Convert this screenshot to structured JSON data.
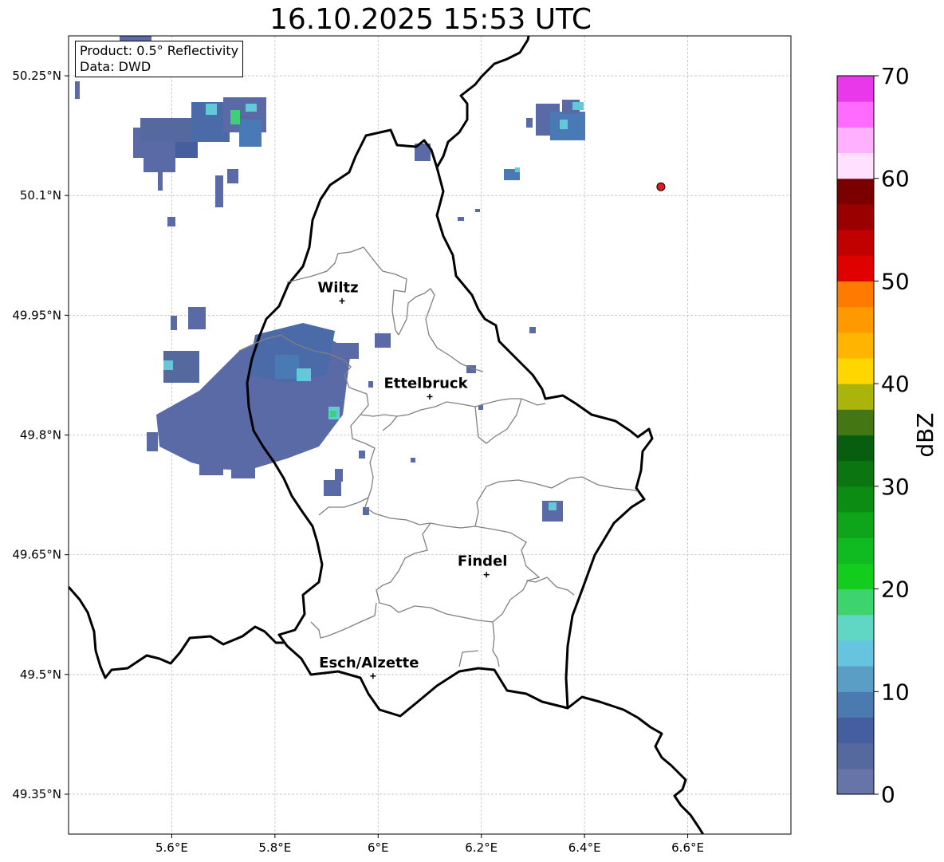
{
  "title": "16.10.2025 15:53 UTC",
  "info": {
    "product": "Product: 0.5° Reflectivity",
    "data": "Data: DWD"
  },
  "map": {
    "lon_range": [
      5.4,
      6.8
    ],
    "lat_range": [
      49.3,
      50.3
    ],
    "lon_ticks": [
      {
        "value": 5.6,
        "label": "5.6°E"
      },
      {
        "value": 5.8,
        "label": "5.8°E"
      },
      {
        "value": 6.0,
        "label": "6°E"
      },
      {
        "value": 6.2,
        "label": "6.2°E"
      },
      {
        "value": 6.4,
        "label": "6.4°E"
      },
      {
        "value": 6.6,
        "label": "6.6°E"
      }
    ],
    "lat_ticks": [
      {
        "value": 50.25,
        "label": "50.25°N"
      },
      {
        "value": 50.1,
        "label": "50.1°N"
      },
      {
        "value": 49.95,
        "label": "49.95°N"
      },
      {
        "value": 49.8,
        "label": "49.8°N"
      },
      {
        "value": 49.65,
        "label": "49.65°N"
      },
      {
        "value": 49.5,
        "label": "49.5°N"
      },
      {
        "value": 49.35,
        "label": "49.35°N"
      }
    ],
    "gridlines": true,
    "cities": [
      {
        "name": "Wiltz",
        "lon": 5.93,
        "lat": 49.968
      },
      {
        "name": "Ettelbruck",
        "lon": 6.1,
        "lat": 49.848
      },
      {
        "name": "Findel",
        "lon": 6.21,
        "lat": 49.625
      },
      {
        "name": "Esch/Alzette",
        "lon": 5.99,
        "lat": 49.498
      }
    ],
    "radar_site": {
      "lon": 6.548,
      "lat": 50.111,
      "color": "#e31a1c"
    }
  },
  "colorbar": {
    "label": "dBZ",
    "min": 0,
    "max": 70,
    "step": 2.5,
    "ticks": [
      0,
      10,
      20,
      30,
      40,
      50,
      60,
      70
    ],
    "colors": [
      "#6674a8",
      "#56699e",
      "#445e9f",
      "#4a7ab0",
      "#5a9ec6",
      "#66c4de",
      "#60d6c4",
      "#3dd46e",
      "#12cc1e",
      "#10bb22",
      "#0fa51a",
      "#0d8c14",
      "#0b7512",
      "#075e0e",
      "#447713",
      "#aab40a",
      "#ffd600",
      "#ffb400",
      "#ff9900",
      "#ff7a00",
      "#e10000",
      "#c10000",
      "#9b0000",
      "#7a0000",
      "#ffe0ff",
      "#ffb0ff",
      "#ff6aff",
      "#e838ea"
    ]
  },
  "echo_colors": {
    "weak": "#5a6aa6",
    "mid": "#4a7ab5",
    "light": "#63c8d8",
    "strong": "#3ecf78"
  }
}
